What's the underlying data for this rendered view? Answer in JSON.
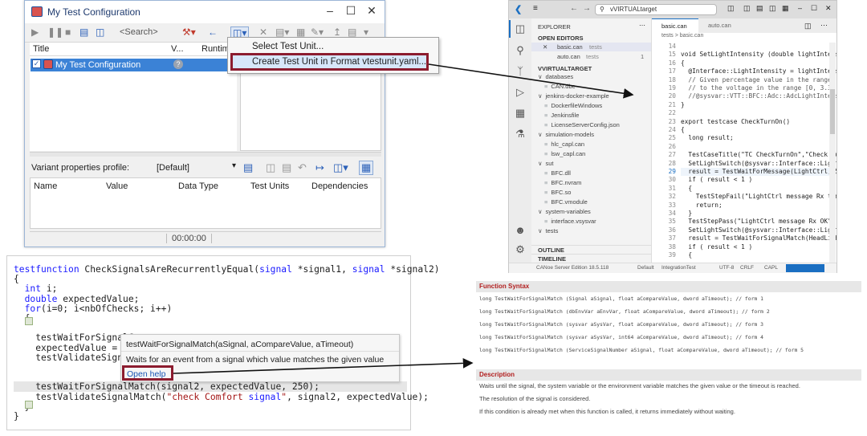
{
  "test_config": {
    "title": "My Test Configuration",
    "search_placeholder": "<Search>",
    "columns": [
      "Title",
      "V...",
      "Runtime"
    ],
    "row_title": "My Test Configuration",
    "context_menu": [
      "Select Test Unit...",
      "Create Test Unit in Format vtestunit.yaml..."
    ],
    "variant_label": "Variant properties profile:",
    "variant_value": "[Default]",
    "vp_columns": [
      "Name",
      "Value",
      "Data Type",
      "Test Units",
      "Dependencies"
    ],
    "status_time": "00:00:00"
  },
  "vscode": {
    "search_text": "vVIRTUALtarget",
    "explorer_title": "EXPLORER",
    "open_editors_label": "OPEN EDITORS",
    "open_editors": [
      {
        "name": "basic.can",
        "hint": "tests"
      },
      {
        "name": "auto.can",
        "hint": "tests"
      }
    ],
    "workspace_label": "VVIRTUALTARGET",
    "tree": [
      {
        "label": "databases",
        "kind": "folder"
      },
      {
        "label": "CAN.dbc",
        "kind": "file"
      },
      {
        "label": "jenkins-docker-example",
        "kind": "folder"
      },
      {
        "label": "DockerfileWindows",
        "kind": "file"
      },
      {
        "label": "Jenkinsfile",
        "kind": "file"
      },
      {
        "label": "LicenseServerConfig.json",
        "kind": "file"
      },
      {
        "label": "simulation-models",
        "kind": "folder"
      },
      {
        "label": "hlc_capl.can",
        "kind": "file"
      },
      {
        "label": "lsw_capl.can",
        "kind": "file"
      },
      {
        "label": "sut",
        "kind": "folder"
      },
      {
        "label": "BFC.dll",
        "kind": "file"
      },
      {
        "label": "BFC.nvram",
        "kind": "file"
      },
      {
        "label": "BFC.so",
        "kind": "file"
      },
      {
        "label": "BFC.vmodule",
        "kind": "file"
      },
      {
        "label": "system-variables",
        "kind": "folder"
      },
      {
        "label": "interface.vsysvar",
        "kind": "file"
      },
      {
        "label": "tests",
        "kind": "folder"
      }
    ],
    "outline_label": "OUTLINE",
    "timeline_label": "TIMELINE",
    "tabs": [
      "basic.can",
      "auto.can"
    ],
    "breadcrumb": "tests > basic.can",
    "code_lines": [
      {
        "n": "14",
        "t": ""
      },
      {
        "n": "15",
        "t": "void SetLightIntensity (double lightIntensity"
      },
      {
        "n": "16",
        "t": "{"
      },
      {
        "n": "17",
        "t": "  @Interface::LightIntensity = lightIntensity"
      },
      {
        "n": "18",
        "t": "  // Given percentage value in the range [0,"
      },
      {
        "n": "19",
        "t": "  // to the voltage in the range [0, 3.3] as"
      },
      {
        "n": "20",
        "t": "  //@sysvar::VTT::BFC::Adc::AdcLightIntensity"
      },
      {
        "n": "21",
        "t": "}"
      },
      {
        "n": "22",
        "t": ""
      },
      {
        "n": "23",
        "t": "export testcase CheckTurnOn()"
      },
      {
        "n": "24",
        "t": "{"
      },
      {
        "n": "25",
        "t": "  long result;"
      },
      {
        "n": "26",
        "t": ""
      },
      {
        "n": "27",
        "t": "  TestCaseTitle(\"TC CheckTurnOn\",\"Check turni"
      },
      {
        "n": "28",
        "t": "  SetLightSwitch(@sysvar::Interface::LightSwi"
      },
      {
        "n": "29",
        "t": "  result = TestWaitForMessage(LightCtrl, 500)"
      },
      {
        "n": "30",
        "t": "  if ( result < 1 )"
      },
      {
        "n": "31",
        "t": "  {"
      },
      {
        "n": "32",
        "t": "    TestStepFail(\"LightCtrl message Rx timeou"
      },
      {
        "n": "33",
        "t": "    return;"
      },
      {
        "n": "34",
        "t": "  }"
      },
      {
        "n": "35",
        "t": "  TestStepPass(\"LightCtrl message Rx OK\");"
      },
      {
        "n": "36",
        "t": "  SetLightSwitch(@sysvar::Interface::LightSwi"
      },
      {
        "n": "37",
        "t": "  result = TestWaitForSignalMatch(HeadLight,1"
      },
      {
        "n": "38",
        "t": "  if ( result < 1 )"
      },
      {
        "n": "39",
        "t": "  {"
      }
    ],
    "status_items": [
      "CANoe Server Edition 18.5.118",
      "Default",
      "IntegrationTest",
      "UTF-8",
      "CRLF",
      "CAPL"
    ]
  },
  "capl_editor": {
    "lines": [
      "testfunction CheckSignalsAreRecurrentlyEqual(signal *signal1, signal *signal2)",
      "{",
      "  int i;",
      "  double expectedValue;",
      "  for(i=0; i<nbOfChecks; i++)",
      "  {",
      "",
      "    testWaitForSignalC",
      "    expectedValue = ge",
      "    testValidateSignal",
      "",
      "",
      "    testWaitForSignalMatch(signal2, expectedValue, 250);",
      "    testValidateSignalMatch(\"check Comfort signal\", signal2, expectedValue);",
      "  }",
      "}"
    ],
    "tooltip_signature": "testWaitForSignalMatch(aSignal, aCompareValue, aTimeout)",
    "tooltip_desc": "Waits for an event from a signal which value matches the given value",
    "open_help": "Open help"
  },
  "help": {
    "syntax_title": "Function Syntax",
    "syntax_lines": [
      "long TestWaitForSignalMatch (Signal aSignal, float aCompareValue, dword aTimeout); // form 1",
      "long TestWaitForSignalMatch (dbEnvVar aEnvVar, float aCompareValue, dword aTimeout); // form 2",
      "long TestWaitForSignalMatch (sysvar aSysVar, float aCompareValue, dword aTimeout); // form 3",
      "long TestWaitForSignalMatch (sysvar aSysVar, int64 aCompareValue, dword aTimeout); // form 4",
      "long TestWaitForSignalMatch (ServiceSignalNumber aSignal, float aCompareValue, dword aTimeout); // form 5"
    ],
    "desc_title": "Description",
    "desc_lines": [
      "Waits until the signal, the system variable or the environment variable matches the given value or the timeout is reached.",
      "The resolution of the signal is considered.",
      "If this condition is already met when this function is called, it returns immediately without waiting."
    ]
  },
  "colors": {
    "highlight_border": "#8c1c2f",
    "selection": "#3b82d6"
  }
}
